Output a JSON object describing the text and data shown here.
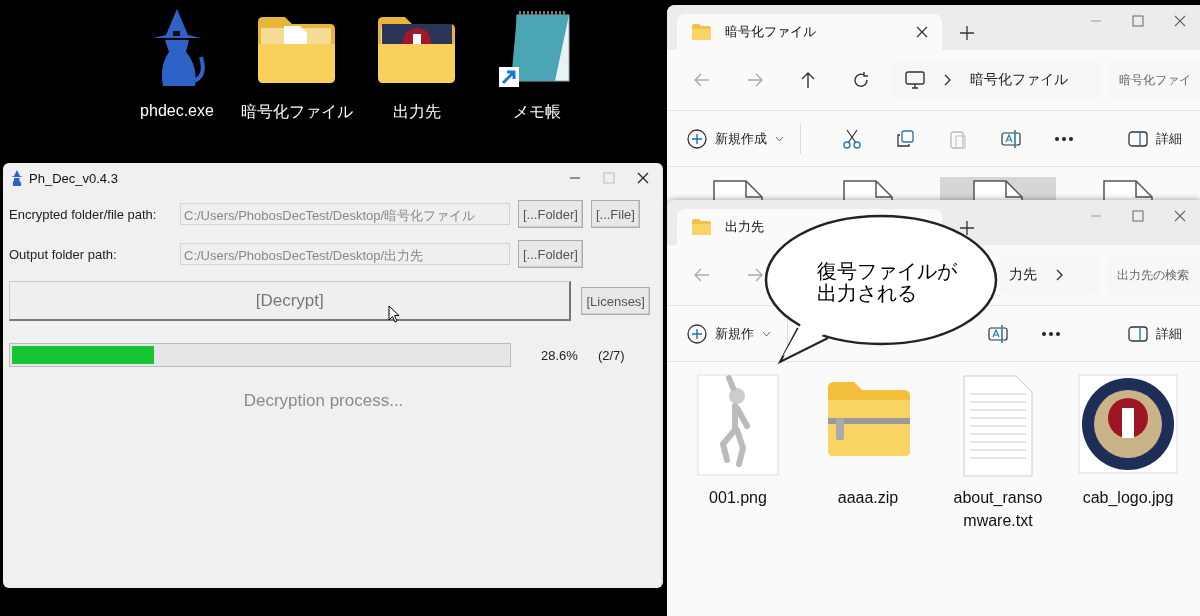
{
  "desktop_icons": [
    {
      "label": "phdec.exe",
      "kind": "app"
    },
    {
      "label": "暗号化ファイル",
      "kind": "folder"
    },
    {
      "label": "出力先",
      "kind": "folder-image"
    },
    {
      "label": "メモ帳",
      "kind": "notepad"
    }
  ],
  "decrypter": {
    "title": "Ph_Dec_v0.4.3",
    "rows": [
      {
        "label": "Encrypted folder/file path:",
        "path": "C:/Users/PhobosDecTest/Desktop/暗号化ファイル",
        "disabled": true,
        "buttons": [
          "[...Folder]",
          "[...File]"
        ]
      },
      {
        "label": "Output folder path:",
        "path": "C:/Users/PhobosDecTest/Desktop/出力先",
        "disabled": true,
        "buttons": [
          "[...Folder]"
        ]
      }
    ],
    "decrypt_button": {
      "label": "[Decrypt]",
      "disabled": true
    },
    "licenses_button": "[Licenses]",
    "progress": {
      "level": 0.286,
      "percent": "28.6%",
      "count": "(2/7)"
    },
    "status": "Decryption process..."
  },
  "explorers": [
    {
      "tab": "暗号化ファイル",
      "address": {
        "text": "暗号化ファイル",
        "root_icon": true,
        "trailing_chevron": false
      },
      "search": "暗号化ファイ",
      "new_button": "新規作成",
      "tools": [
        {
          "kind": "cut"
        },
        {
          "kind": "copy"
        },
        {
          "kind": "paste"
        },
        {
          "kind": "rename"
        },
        {
          "kind": "more"
        }
      ],
      "details_button": "詳細",
      "files": [
        {
          "kind": "blank",
          "selected": false
        },
        {
          "kind": "blank",
          "selected": false
        },
        {
          "kind": "blank",
          "selected": true
        },
        {
          "kind": "blank",
          "selected": false
        }
      ]
    },
    {
      "tab": "出力先",
      "address": {
        "text": "力先",
        "root_icon": false,
        "trailing_chevron": true
      },
      "search": "出力先の検索",
      "new_button": "新規作",
      "tools": [
        {
          "kind": "rename"
        },
        {
          "kind": "more"
        }
      ],
      "details_button": "詳細",
      "files": [
        {
          "kind": "figure",
          "name": "001.png",
          "selected": false
        },
        {
          "kind": "zip",
          "name": "aaaa.zip",
          "selected": false
        },
        {
          "kind": "text",
          "name": "about_ransomware.txt",
          "selected": false
        },
        {
          "kind": "emblem",
          "name": "cab_logo.jpg",
          "selected": false
        }
      ]
    }
  ],
  "callout": {
    "text": "復号ファイルが出力される"
  }
}
